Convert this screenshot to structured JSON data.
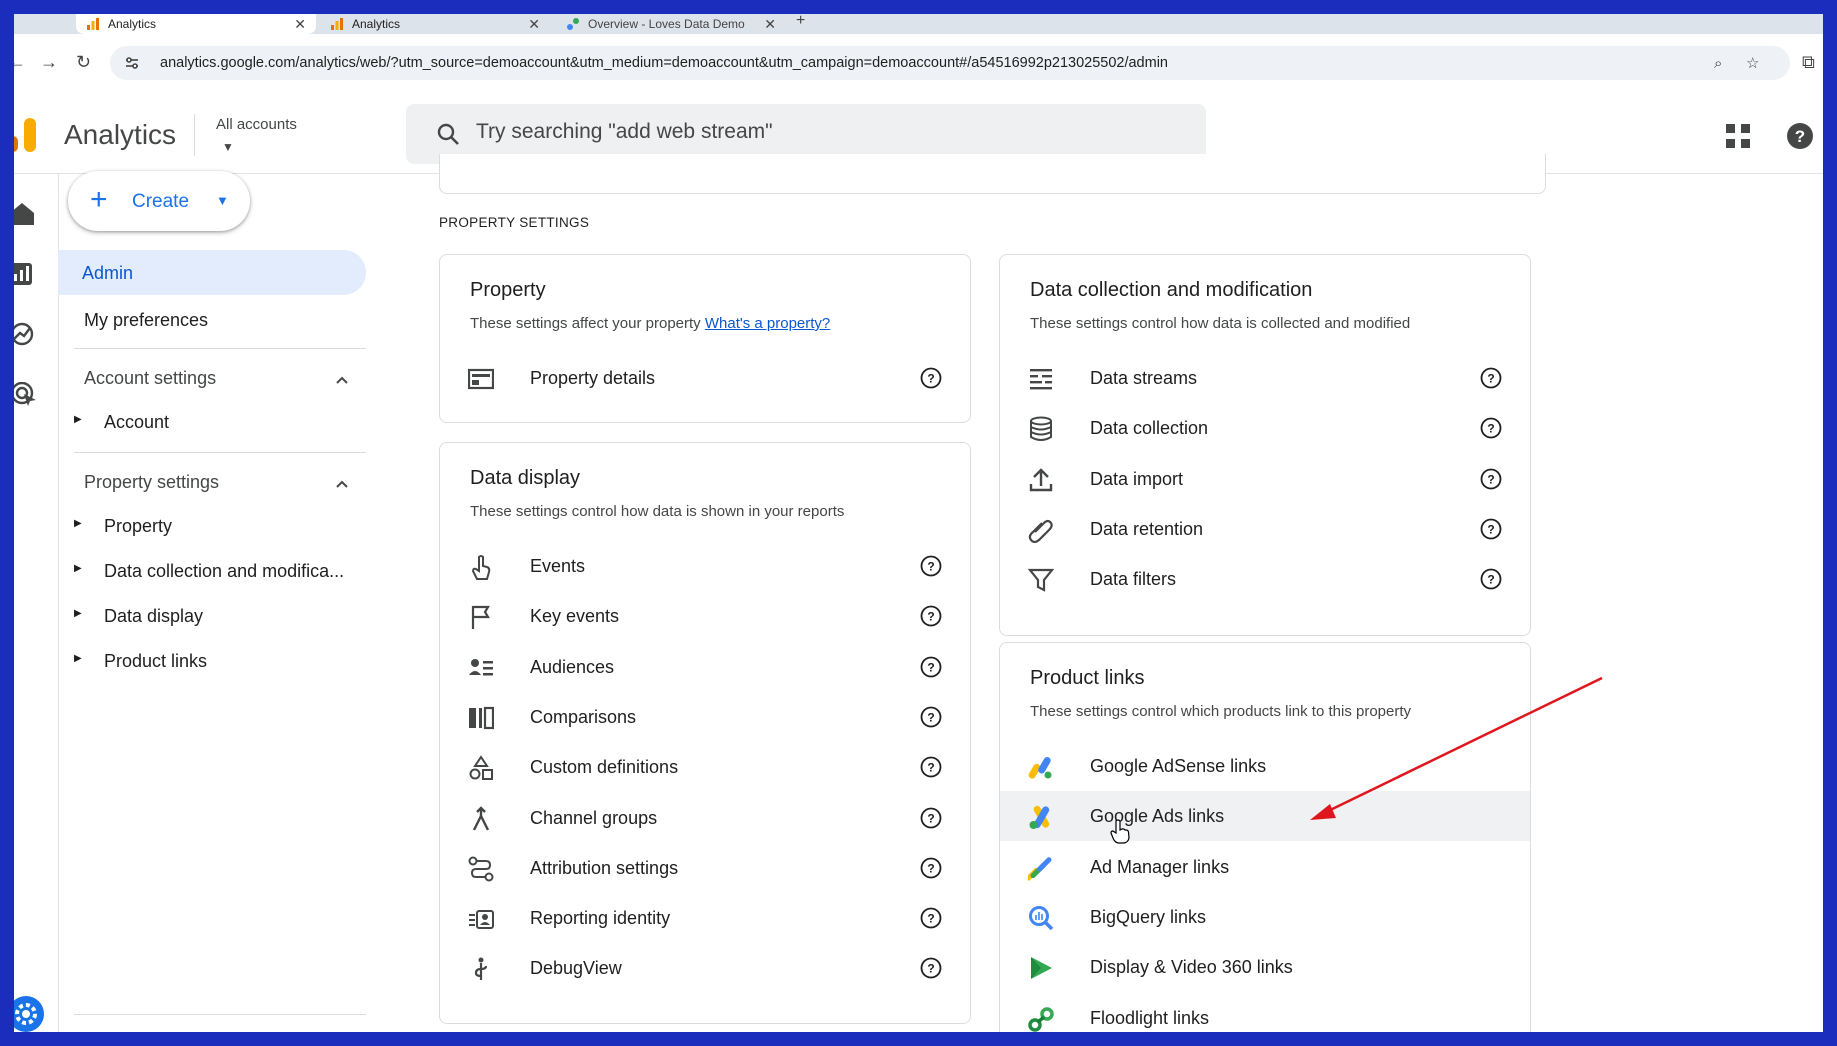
{
  "browser": {
    "tabs": [
      {
        "title": "Analytics",
        "active": true
      },
      {
        "title": "Analytics",
        "active": false
      },
      {
        "title": "Overview - Loves Data Demo",
        "active": false
      }
    ],
    "url": "analytics.google.com/analytics/web/?utm_source=demoaccount&utm_medium=demoaccount&utm_campaign=demoaccount#/a54516992p213025502/admin"
  },
  "header": {
    "app_title": "Analytics",
    "account_selector": "All accounts",
    "search_placeholder": "Try searching \"add web stream\""
  },
  "sidebar": {
    "create_label": "Create",
    "admin": "Admin",
    "my_preferences": "My preferences",
    "account_settings": {
      "title": "Account settings",
      "items": [
        "Account"
      ]
    },
    "property_settings": {
      "title": "Property settings",
      "items": [
        "Property",
        "Data collection and modifica...",
        "Data display",
        "Product links"
      ]
    }
  },
  "main": {
    "section_label": "PROPERTY SETTINGS",
    "property_card": {
      "title": "Property",
      "desc": "These settings affect your property",
      "desc_link": "What's a property?",
      "rows": [
        {
          "label": "Property details",
          "icon": "property-details-icon"
        }
      ]
    },
    "data_display_card": {
      "title": "Data display",
      "desc": "These settings control how data is shown in your reports",
      "rows": [
        {
          "label": "Events",
          "icon": "touch-icon"
        },
        {
          "label": "Key events",
          "icon": "flag-icon"
        },
        {
          "label": "Audiences",
          "icon": "audience-icon"
        },
        {
          "label": "Comparisons",
          "icon": "comparisons-icon"
        },
        {
          "label": "Custom definitions",
          "icon": "shapes-icon"
        },
        {
          "label": "Channel groups",
          "icon": "merge-icon"
        },
        {
          "label": "Attribution settings",
          "icon": "route-icon"
        },
        {
          "label": "Reporting identity",
          "icon": "badge-icon"
        },
        {
          "label": "DebugView",
          "icon": "debug-icon"
        }
      ]
    },
    "data_collection_card": {
      "title": "Data collection and modification",
      "desc": "These settings control how data is collected and modified",
      "rows": [
        {
          "label": "Data streams",
          "icon": "streams-icon"
        },
        {
          "label": "Data collection",
          "icon": "database-icon"
        },
        {
          "label": "Data import",
          "icon": "upload-icon"
        },
        {
          "label": "Data retention",
          "icon": "attach-icon"
        },
        {
          "label": "Data filters",
          "icon": "filter-icon"
        }
      ]
    },
    "product_links_card": {
      "title": "Product links",
      "desc": "These settings control which products link to this property",
      "rows": [
        {
          "label": "Google AdSense links",
          "icon": "adsense-icon"
        },
        {
          "label": "Google Ads links",
          "icon": "google-ads-icon",
          "hovered": true
        },
        {
          "label": "Ad Manager links",
          "icon": "ad-manager-icon"
        },
        {
          "label": "BigQuery links",
          "icon": "bigquery-icon"
        },
        {
          "label": "Display & Video 360 links",
          "icon": "dv360-icon"
        },
        {
          "label": "Floodlight links",
          "icon": "floodlight-icon"
        }
      ]
    }
  },
  "colors": {
    "frame": "#1a2dbd",
    "accent": "#1a73e8",
    "nav_selected_bg": "#e3ecfc",
    "annotation_arrow": "#e0161e"
  }
}
